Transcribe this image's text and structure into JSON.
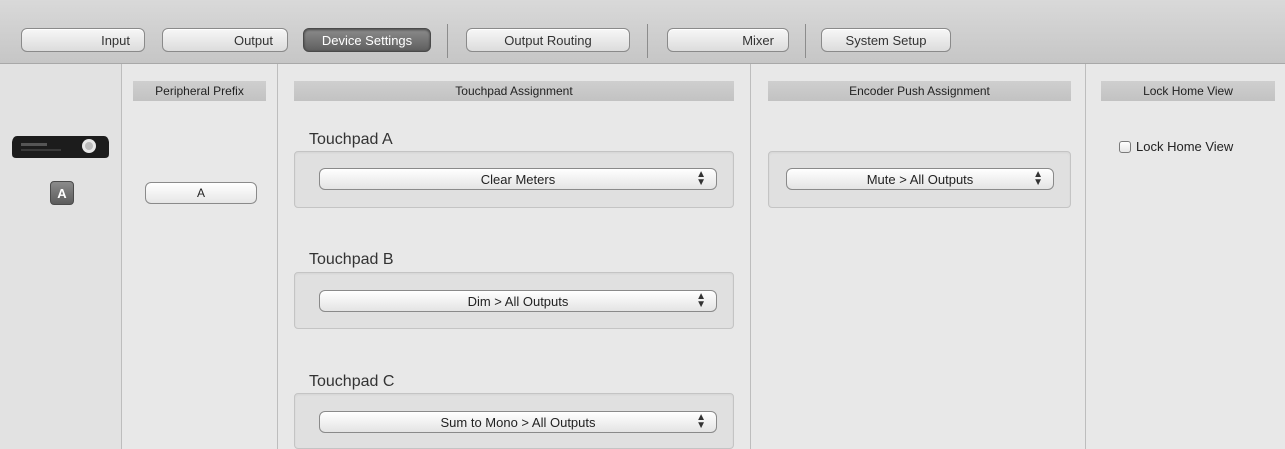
{
  "toolbar": {
    "tabs": [
      {
        "label": "Input"
      },
      {
        "label": "Output"
      },
      {
        "label": "Device Settings",
        "active": true
      },
      {
        "label": "Output Routing"
      },
      {
        "label": "Mixer"
      },
      {
        "label": "System Setup"
      }
    ]
  },
  "device": {
    "icon": "audio-interface-icon",
    "peripheral_badge": "A"
  },
  "peripheral_prefix": {
    "header": "Peripheral Prefix",
    "value": "A"
  },
  "touchpad_assignment": {
    "header": "Touchpad Assignment",
    "touchpads": [
      {
        "label": "Touchpad A",
        "value": "Clear Meters"
      },
      {
        "label": "Touchpad B",
        "value": "Dim > All Outputs"
      },
      {
        "label": "Touchpad C",
        "value": "Sum to Mono > All Outputs"
      }
    ]
  },
  "encoder_push_assignment": {
    "header": "Encoder Push Assignment",
    "value": "Mute > All Outputs"
  },
  "lock_home_view": {
    "header": "Lock Home View",
    "checkbox_label": "Lock Home View",
    "checked": false
  },
  "colors": {
    "active_tab": "#6e6e6e",
    "background": "#e8e8e8",
    "header": "#c8c8c8"
  }
}
